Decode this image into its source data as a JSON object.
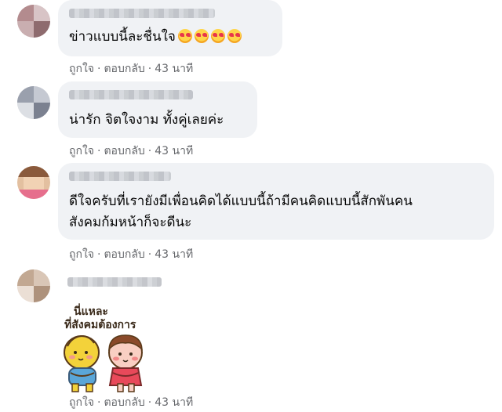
{
  "comments": [
    {
      "text": "ข่าวแบบนี้ละชื่นใจ",
      "emoji_count": 4,
      "emoji_icon": "smiling-face-with-hearts-icon",
      "actions": {
        "like": "ถูกใจ",
        "reply": "ตอบกลับ",
        "time": "43 นาที"
      }
    },
    {
      "text": "น่ารัก จิตใจงาม ทั้งคู่เลยค่ะ",
      "actions": {
        "like": "ถูกใจ",
        "reply": "ตอบกลับ",
        "time": "43 นาที"
      }
    },
    {
      "text_lines": [
        "ดีใจครับที่เรายังมีเพื่อนคิดได้แบบนี้ถ้ามีคนคิดแบบนี้สักพันคน",
        "สังคมก้มหน้าก็จะดีนะ"
      ],
      "actions": {
        "like": "ถูกใจ",
        "reply": "ตอบกลับ",
        "time": "43 นาที"
      }
    },
    {
      "sticker_caption_lines": [
        "นี่แหละ",
        "ที่สังคมต้องการ"
      ],
      "actions": {
        "like": "ถูกใจ",
        "reply": "ตอบกลับ",
        "time": "43 นาที"
      }
    }
  ],
  "separator": "·",
  "colors": {
    "bubble": "#f0f2f5",
    "meta_text": "#65676b",
    "text": "#050505"
  }
}
